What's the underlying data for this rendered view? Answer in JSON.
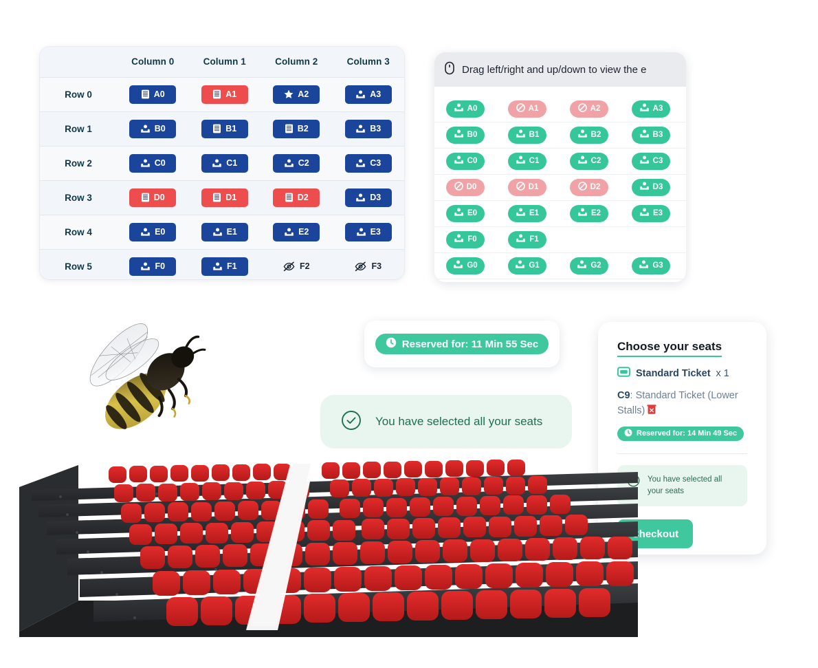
{
  "colors": {
    "seat_blue": "#1a459b",
    "seat_red": "#ee4d4d",
    "map_free_green": "#35c79a",
    "map_taken_pink": "#f0a2a6",
    "accent_green": "#3fc79d",
    "note_bg": "#e9f6ef",
    "table_bg": "#f4f6f9",
    "hint_bg": "#e9ebee",
    "heading_text": "#0e3a46"
  },
  "seat_table": {
    "column_headers": [
      "Column 0",
      "Column 1",
      "Column 2",
      "Column 3"
    ],
    "rows": [
      {
        "label": "Row 0",
        "cells": [
          {
            "label": "A0",
            "icon": "ticket-icon",
            "state": "available",
            "style": "blue"
          },
          {
            "label": "A1",
            "icon": "ticket-icon",
            "state": "unavailable",
            "style": "red"
          },
          {
            "label": "A2",
            "icon": "star-icon",
            "state": "available",
            "style": "blue"
          },
          {
            "label": "A3",
            "icon": "seat-icon",
            "state": "available",
            "style": "blue"
          }
        ]
      },
      {
        "label": "Row 1",
        "cells": [
          {
            "label": "B0",
            "icon": "seat-icon",
            "state": "available",
            "style": "blue"
          },
          {
            "label": "B1",
            "icon": "ticket-icon",
            "state": "available",
            "style": "blue"
          },
          {
            "label": "B2",
            "icon": "ticket-icon",
            "state": "available",
            "style": "blue"
          },
          {
            "label": "B3",
            "icon": "seat-icon",
            "state": "available",
            "style": "blue"
          }
        ]
      },
      {
        "label": "Row 2",
        "cells": [
          {
            "label": "C0",
            "icon": "seat-icon",
            "state": "available",
            "style": "blue"
          },
          {
            "label": "C1",
            "icon": "seat-icon",
            "state": "available",
            "style": "blue"
          },
          {
            "label": "C2",
            "icon": "seat-icon",
            "state": "available",
            "style": "blue"
          },
          {
            "label": "C3",
            "icon": "seat-icon",
            "state": "available",
            "style": "blue"
          }
        ]
      },
      {
        "label": "Row 3",
        "cells": [
          {
            "label": "D0",
            "icon": "ticket-icon",
            "state": "unavailable",
            "style": "red"
          },
          {
            "label": "D1",
            "icon": "ticket-icon",
            "state": "unavailable",
            "style": "red"
          },
          {
            "label": "D2",
            "icon": "ticket-icon",
            "state": "unavailable",
            "style": "red"
          },
          {
            "label": "D3",
            "icon": "seat-icon",
            "state": "available",
            "style": "blue"
          }
        ]
      },
      {
        "label": "Row 4",
        "cells": [
          {
            "label": "E0",
            "icon": "seat-icon",
            "state": "available",
            "style": "blue"
          },
          {
            "label": "E1",
            "icon": "seat-icon",
            "state": "available",
            "style": "blue"
          },
          {
            "label": "E2",
            "icon": "seat-icon",
            "state": "available",
            "style": "blue"
          },
          {
            "label": "E3",
            "icon": "seat-icon",
            "state": "available",
            "style": "blue"
          }
        ]
      },
      {
        "label": "Row 5",
        "cells": [
          {
            "label": "F0",
            "icon": "seat-icon",
            "state": "available",
            "style": "blue"
          },
          {
            "label": "F1",
            "icon": "seat-icon",
            "state": "available",
            "style": "blue"
          },
          {
            "label": "F2",
            "icon": "eye-off-icon",
            "state": "hidden",
            "style": "plain"
          },
          {
            "label": "F3",
            "icon": "eye-off-icon",
            "state": "hidden",
            "style": "plain"
          }
        ]
      }
    ]
  },
  "seat_map": {
    "hint_icon": "mouse-icon",
    "hint_text": "Drag left/right and up/down to view the e",
    "rows": [
      {
        "seats": [
          {
            "label": "A0",
            "state": "available"
          },
          {
            "label": "A1",
            "state": "unavailable"
          },
          {
            "label": "A2",
            "state": "unavailable"
          },
          {
            "label": "A3",
            "state": "available"
          }
        ]
      },
      {
        "seats": [
          {
            "label": "B0",
            "state": "available"
          },
          {
            "label": "B1",
            "state": "available"
          },
          {
            "label": "B2",
            "state": "available"
          },
          {
            "label": "B3",
            "state": "available"
          }
        ]
      },
      {
        "seats": [
          {
            "label": "C0",
            "state": "available"
          },
          {
            "label": "C1",
            "state": "available"
          },
          {
            "label": "C2",
            "state": "available"
          },
          {
            "label": "C3",
            "state": "available"
          }
        ]
      },
      {
        "seats": [
          {
            "label": "D0",
            "state": "unavailable"
          },
          {
            "label": "D1",
            "state": "unavailable"
          },
          {
            "label": "D2",
            "state": "unavailable"
          },
          {
            "label": "D3",
            "state": "available"
          }
        ]
      },
      {
        "seats": [
          {
            "label": "E0",
            "state": "available"
          },
          {
            "label": "E1",
            "state": "available"
          },
          {
            "label": "E2",
            "state": "available"
          },
          {
            "label": "E3",
            "state": "available"
          }
        ]
      },
      {
        "seats": [
          {
            "label": "F0",
            "state": "available"
          },
          {
            "label": "F1",
            "state": "available"
          }
        ]
      },
      {
        "seats": [
          {
            "label": "G0",
            "state": "available"
          },
          {
            "label": "G1",
            "state": "available"
          },
          {
            "label": "G2",
            "state": "available"
          },
          {
            "label": "G3",
            "state": "available"
          }
        ]
      }
    ]
  },
  "reserved_toast": {
    "icon": "clock-icon",
    "text": "Reserved for: 11 Min 55 Sec"
  },
  "selected_toast": {
    "icon": "check-circle-icon",
    "text": "You have selected all your seats"
  },
  "checkout_panel": {
    "title": "Choose your seats",
    "ticket_icon": "ticket-stub-icon",
    "ticket_type": "Standard Ticket",
    "ticket_quantity": "x 1",
    "seat_id": "C9",
    "seat_description": ": Standard Ticket (Lower Stalls)",
    "delete_icon": "trash-icon",
    "timer_icon": "clock-icon",
    "timer_text": "Reserved for: 14 Min 49 Sec",
    "note_icon": "check-circle-icon",
    "note_text": "You have selected all your seats",
    "checkout_label": "Checkout"
  },
  "images": {
    "bee": "bee-photo",
    "theater": "theater-seating-render"
  }
}
